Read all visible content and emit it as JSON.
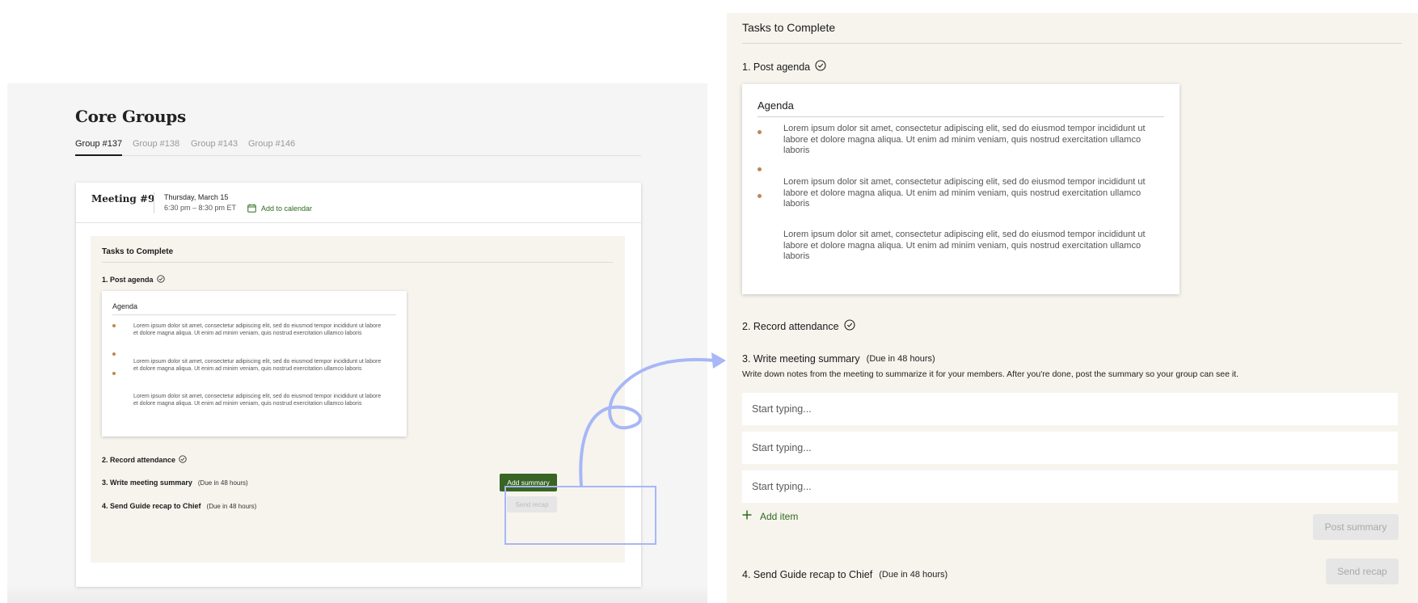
{
  "left": {
    "title": "Core Groups",
    "tabs": [
      {
        "label": "Group #137",
        "active": true
      },
      {
        "label": "Group #138",
        "active": false
      },
      {
        "label": "Group #143",
        "active": false
      },
      {
        "label": "Group #146",
        "active": false
      }
    ],
    "meeting": {
      "title": "Meeting #9",
      "date": "Thursday, March 15",
      "time": "6:30 pm – 8:30 pm ET",
      "calendar_label": "Add to calendar"
    },
    "tasks": {
      "title": "Tasks to Complete",
      "post_agenda": "1.  Post agenda",
      "agenda_title": "Agenda",
      "record_attendance": "2. Record attendance",
      "write_summary": "3. Write meeting summary",
      "write_summary_due": "(Due in 48 hours)",
      "send_recap": "4. Send Guide recap to Chief",
      "send_recap_due": "(Due in 48 hours)",
      "add_summary_label": "Add summary",
      "send_recap_label": "Send recap"
    }
  },
  "agenda_items": [
    "Lorem ipsum dolor sit amet, consectetur adipiscing elit, sed do eiusmod tempor incididunt ut labore et dolore magna aliqua. Ut enim ad minim veniam, quis nostrud exercitation ullamco laboris",
    "Lorem ipsum dolor sit amet, consectetur adipiscing elit, sed do eiusmod tempor incididunt ut labore et dolore magna aliqua. Ut enim ad minim veniam, quis nostrud exercitation ullamco laboris",
    "Lorem ipsum dolor sit amet, consectetur adipiscing elit, sed do eiusmod tempor incididunt ut labore et dolore magna aliqua. Ut enim ad minim veniam, quis nostrud exercitation ullamco laboris"
  ],
  "right": {
    "title": "Tasks to Complete",
    "post_agenda": "1. Post agenda",
    "agenda_title": "Agenda",
    "record_attendance": "2. Record attendance",
    "write_summary": "3. Write meeting summary",
    "write_summary_due": "(Due in 48 hours)",
    "description": "Write down notes from the meeting to summarize it for your members. After you're done, post the summary so your group can see it.",
    "input_placeholder": "Start typing...",
    "add_item_label": "Add item",
    "post_summary_label": "Post summary",
    "send_recap_task": "4. Send Guide recap to Chief",
    "send_recap_due": "(Due in 48 hours)",
    "send_recap_label": "Send recap"
  },
  "colors": {
    "accent_green": "#386424",
    "bullet": "#b98a52",
    "panel_beige": "#f7f4ee",
    "highlight_blue": "#a7b7f7"
  },
  "icons": [
    "check-circle-icon",
    "calendar-icon",
    "plus-icon",
    "arrow-icon"
  ]
}
